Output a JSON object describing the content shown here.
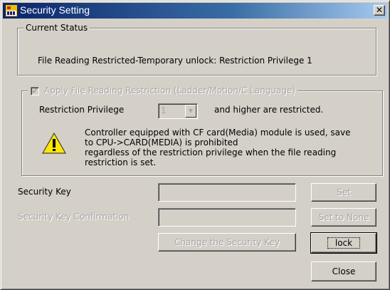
{
  "window": {
    "title": "Security Setting",
    "close_symbol": "✕"
  },
  "current_status": {
    "legend": "Current Status",
    "text": "File Reading Restricted-Temporary unlock: Restriction Privilege 1"
  },
  "apply_group": {
    "checkbox_label": "Apply File Reading Restriction (Ladder/Motion/C Language)",
    "checked": true,
    "restriction_privilege_label": "Restriction Privilege",
    "restriction_privilege_value": "1",
    "restricted_suffix": "and higher are restricted.",
    "warning_icon": "warning-triangle-icon",
    "warning_lines": [
      "Controller equipped with CF card(Media) module is used, save",
      "to CPU->CARD(MEDIA) is prohibited",
      "regardless of the restriction privilege when the file reading",
      "restriction is set."
    ]
  },
  "security_key": {
    "label": "Security Key",
    "value": ""
  },
  "security_key_confirmation": {
    "label": "Security Key Confirmation",
    "value": ""
  },
  "buttons": {
    "set": "Set",
    "set_to_none": "Set to None",
    "change_key": "Change the Security Key",
    "lock": "lock",
    "close": "Close"
  }
}
